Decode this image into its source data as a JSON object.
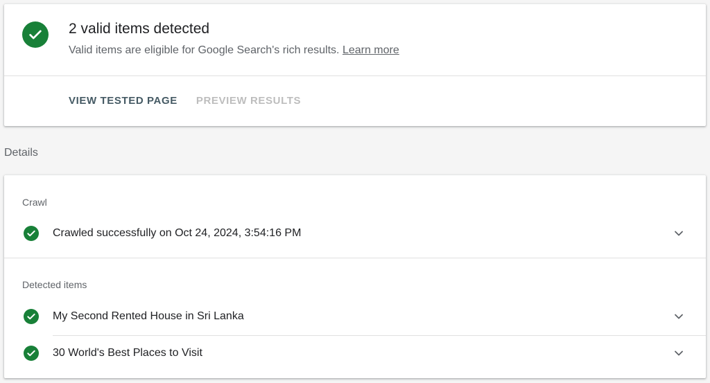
{
  "summary": {
    "title": "2 valid items detected",
    "subtitle": "Valid items are eligible for Google Search's rich results.",
    "learn_more": "Learn more",
    "actions": {
      "view_tested_page": "VIEW TESTED PAGE",
      "preview_results": "PREVIEW RESULTS"
    }
  },
  "details_heading": "Details",
  "crawl": {
    "label": "Crawl",
    "status": "Crawled successfully on Oct 24, 2024, 3:54:16 PM"
  },
  "detected": {
    "label": "Detected items",
    "items": [
      {
        "label": "My Second Rented House in Sri Lanka"
      },
      {
        "label": "30 World's Best Places to Visit"
      }
    ]
  },
  "colors": {
    "success": "#188038",
    "primary_action": "#455a64",
    "disabled_action": "#bdbdbd"
  },
  "icons": {
    "check": "check-circle-icon",
    "expand": "chevron-down-icon"
  }
}
